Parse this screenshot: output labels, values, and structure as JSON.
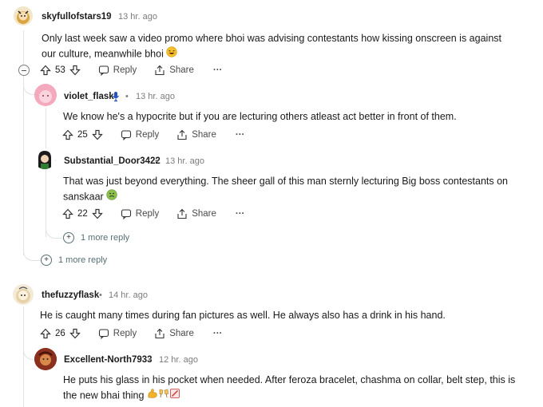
{
  "comments": [
    {
      "author": "skyfullofstars19",
      "time": "13 hr. ago",
      "body": "Only last week saw a video promo where bhoi was advising contestants how kissing onscreen is against our culture, meanwhile bhoi",
      "votes": "53",
      "emoji": "laughing-face"
    },
    {
      "author": "violet_flask",
      "time": "13 hr. ago",
      "body": "We know he's a hypocrite but if you are lecturing others atleast act better in front of them.",
      "votes": "25"
    },
    {
      "author": "Substantial_Door3422",
      "time": "13 hr. ago",
      "body": "That was just beyond everything. The sheer gall of this man sternly lecturing Big boss contestants on sanskaar",
      "votes": "22",
      "emoji": "nauseated-face"
    },
    {
      "author": "thefuzzyflask",
      "time": "14 hr. ago",
      "body": "He is caught many times during fan pictures as well. He always also has a drink in his hand.",
      "votes": "26"
    },
    {
      "author": "Excellent-North7933",
      "time": "12 hr. ago",
      "body": "He puts his glass in his pocket when needed. After feroza bracelet, chashma on collar, belt step, this is the new bhai thing"
    }
  ],
  "labels": {
    "reply": "Reply",
    "share": "Share",
    "more_dots": "···",
    "separator": "•"
  },
  "more_replies": {
    "nested": "1 more reply",
    "top": "1 more reply"
  },
  "colors": {
    "text": "#1a1a1b",
    "meta": "#7c7c7c",
    "thread": "#e0e3e6"
  }
}
